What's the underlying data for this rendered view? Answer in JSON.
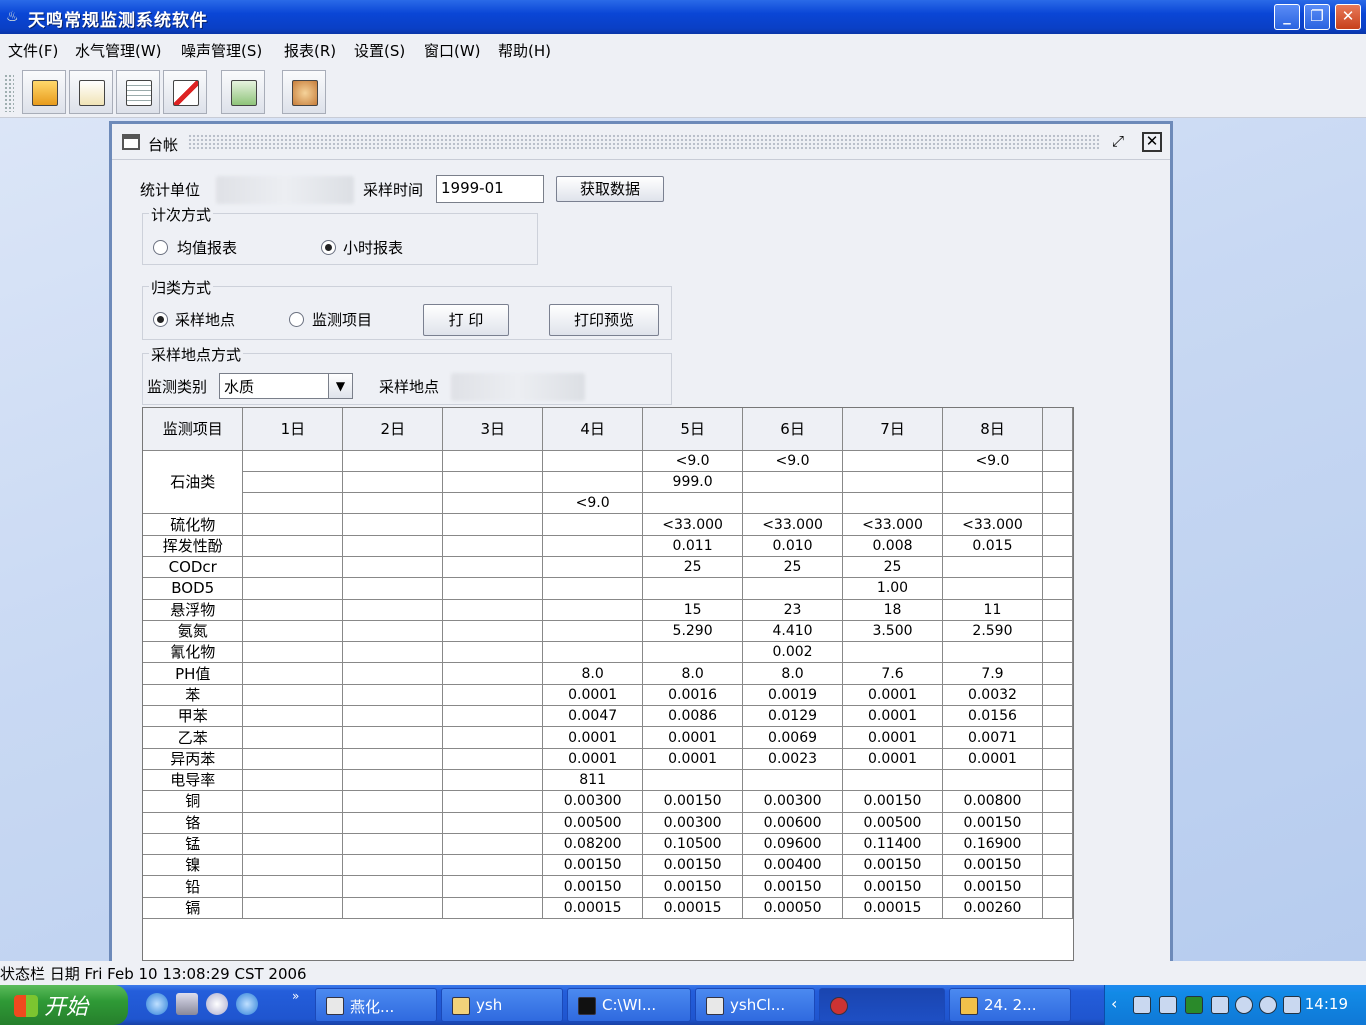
{
  "app": {
    "title": "天鸣常规监测系统软件"
  },
  "menu": [
    "文件(F)",
    "水气管理(W)",
    "噪声管理(S)",
    "报表(R)",
    "设置(S)",
    "窗口(W)",
    "帮助(H)"
  ],
  "toolbar": {
    "icons": [
      "open-folder-icon",
      "edit-note-icon",
      "list-icon",
      "pencil-report-icon",
      "chart-sheet-icon",
      "settings-icon"
    ]
  },
  "frame": {
    "title": "台帐"
  },
  "form": {
    "unit_label": "统计单位",
    "time_label": "采样时间",
    "time_value": "1999-01",
    "fetch_button": "获取数据",
    "count_group": "计次方式",
    "radio_avg": "均值报表",
    "radio_hour": "小时报表",
    "classify_group": "归类方式",
    "radio_site": "采样地点",
    "radio_item": "监测项目",
    "print_button": "打 印",
    "preview_button": "打印预览",
    "site_group": "采样地点方式",
    "category_label": "监测类别",
    "category_value": "水质",
    "site_label": "采样地点"
  },
  "table": {
    "headers": [
      "监测项目",
      "1日",
      "2日",
      "3日",
      "4日",
      "5日",
      "6日",
      "7日",
      "8日",
      ""
    ],
    "oil_label": "石油类",
    "oil_rows": [
      [
        "",
        "",
        "",
        "",
        "<9.0",
        "<9.0",
        "",
        "<9.0"
      ],
      [
        "",
        "",
        "",
        "",
        "999.0",
        "",
        "",
        ""
      ],
      [
        "",
        "",
        "",
        "<9.0",
        "",
        "",
        "",
        ""
      ]
    ],
    "rows": [
      [
        "硫化物",
        "",
        "",
        "",
        "",
        "<33.000",
        "<33.000",
        "<33.000",
        "<33.000"
      ],
      [
        "挥发性酚",
        "",
        "",
        "",
        "",
        "0.011",
        "0.010",
        "0.008",
        "0.015"
      ],
      [
        "CODcr",
        "",
        "",
        "",
        "",
        "25",
        "25",
        "25",
        ""
      ],
      [
        "BOD5",
        "",
        "",
        "",
        "",
        "",
        "",
        "1.00",
        ""
      ],
      [
        "悬浮物",
        "",
        "",
        "",
        "",
        "15",
        "23",
        "18",
        "11"
      ],
      [
        "氨氮",
        "",
        "",
        "",
        "",
        "5.290",
        "4.410",
        "3.500",
        "2.590"
      ],
      [
        "氰化物",
        "",
        "",
        "",
        "",
        "",
        "0.002",
        "",
        ""
      ],
      [
        "PH值",
        "",
        "",
        "",
        "8.0",
        "8.0",
        "8.0",
        "7.6",
        "7.9"
      ],
      [
        "苯",
        "",
        "",
        "",
        "0.0001",
        "0.0016",
        "0.0019",
        "0.0001",
        "0.0032"
      ],
      [
        "甲苯",
        "",
        "",
        "",
        "0.0047",
        "0.0086",
        "0.0129",
        "0.0001",
        "0.0156"
      ],
      [
        "乙苯",
        "",
        "",
        "",
        "0.0001",
        "0.0001",
        "0.0069",
        "0.0001",
        "0.0071"
      ],
      [
        "异丙苯",
        "",
        "",
        "",
        "0.0001",
        "0.0001",
        "0.0023",
        "0.0001",
        "0.0001"
      ],
      [
        "电导率",
        "",
        "",
        "",
        "811",
        "",
        "",
        "",
        ""
      ],
      [
        "铜",
        "",
        "",
        "",
        "0.00300",
        "0.00150",
        "0.00300",
        "0.00150",
        "0.00800"
      ],
      [
        "铬",
        "",
        "",
        "",
        "0.00500",
        "0.00300",
        "0.00600",
        "0.00500",
        "0.00150"
      ],
      [
        "锰",
        "",
        "",
        "",
        "0.08200",
        "0.10500",
        "0.09600",
        "0.11400",
        "0.16900"
      ],
      [
        "镍",
        "",
        "",
        "",
        "0.00150",
        "0.00150",
        "0.00400",
        "0.00150",
        "0.00150"
      ],
      [
        "铅",
        "",
        "",
        "",
        "0.00150",
        "0.00150",
        "0.00150",
        "0.00150",
        "0.00150"
      ],
      [
        "镉",
        "",
        "",
        "",
        "0.00015",
        "0.00015",
        "0.00050",
        "0.00015",
        "0.00260"
      ]
    ]
  },
  "status": {
    "text": "状态栏 日期 Fri Feb 10 13:08:29 CST 2006"
  },
  "taskbar": {
    "start": "开始",
    "tasks": [
      "燕化...",
      "ysh",
      "C:\\WI...",
      "yshCl...",
      "",
      "24. 2..."
    ],
    "clock": "14:19"
  }
}
